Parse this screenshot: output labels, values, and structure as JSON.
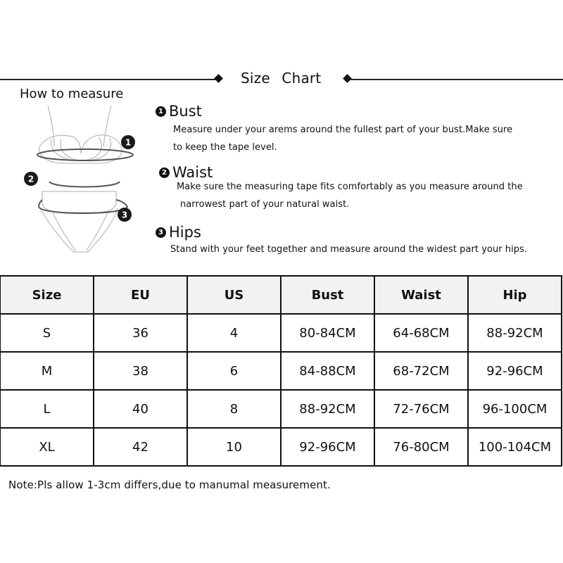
{
  "title": {
    "left_word": "Size",
    "right_word": "Chart",
    "full": "Size Chart"
  },
  "how_to_measure": {
    "heading": "How to measure",
    "illustration": {
      "markers": [
        "1",
        "2",
        "3"
      ]
    },
    "steps": [
      {
        "number": "1",
        "name": "Bust",
        "lines": [
          "Measure under your arems around the fullest part of your bust.Make sure",
          "to keep the tape level."
        ]
      },
      {
        "number": "2",
        "name": "Waist",
        "lines": [
          "Make sure the measuring tape fits comfortably as you measure around the",
          "narrowest part of your natural waist."
        ]
      },
      {
        "number": "3",
        "name": "Hips",
        "lines": [
          "Stand with your feet together and measure around the widest part your hips."
        ]
      }
    ]
  },
  "table": {
    "headers": [
      "Size",
      "EU",
      "US",
      "Bust",
      "Waist",
      "Hip"
    ],
    "rows": [
      [
        "S",
        "36",
        "4",
        "80-84CM",
        "64-68CM",
        "88-92CM"
      ],
      [
        "M",
        "38",
        "6",
        "84-88CM",
        "68-72CM",
        "92-96CM"
      ],
      [
        "L",
        "40",
        "8",
        "88-92CM",
        "72-76CM",
        "96-100CM"
      ],
      [
        "XL",
        "42",
        "10",
        "92-96CM",
        "76-80CM",
        "100-104CM"
      ]
    ]
  },
  "note": "Note:Pls allow 1-3cm differs,due to manumal measurement."
}
